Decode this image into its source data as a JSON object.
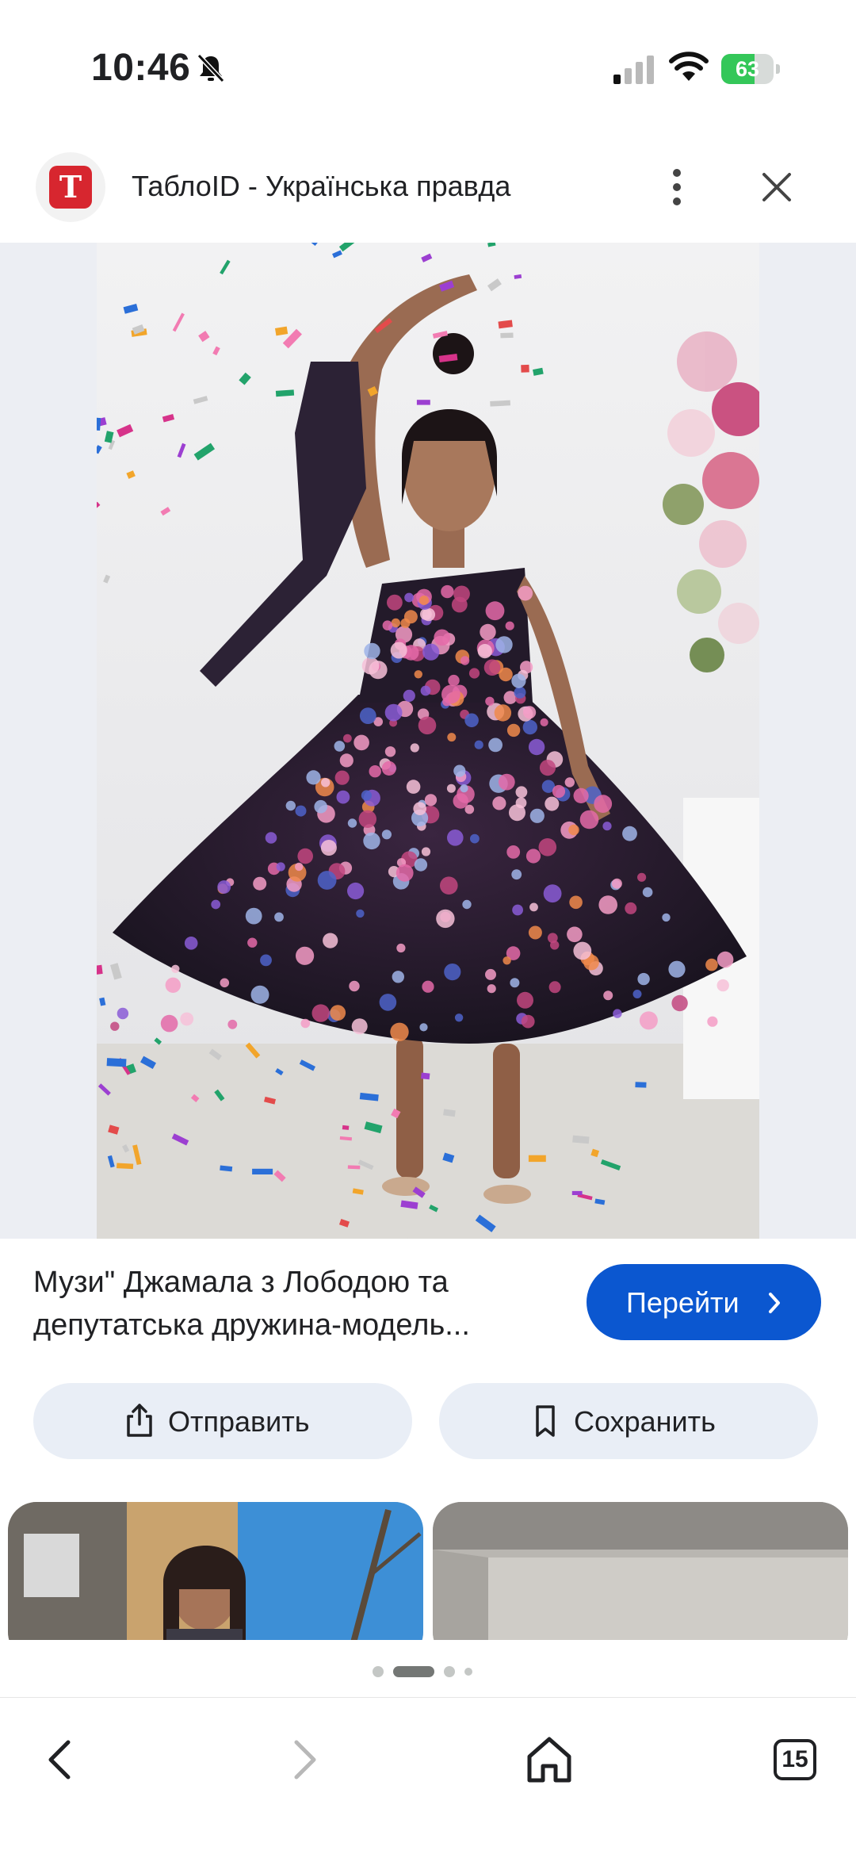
{
  "status_bar": {
    "time": "10:46",
    "battery_percent": "63",
    "battery_level": 0.63,
    "icons": [
      "bell-slash-icon",
      "cellular-signal-icon",
      "wifi-icon",
      "battery-charging-icon"
    ]
  },
  "source": {
    "favicon_letter": "T",
    "title": "ТаблоID - Українська правда",
    "brand_color": "#d7262f"
  },
  "caption": {
    "line1": "Музи\" Джамала з Лободою та",
    "line2": "депутатська дружина-модель..."
  },
  "visit_button": {
    "label": "Перейти"
  },
  "actions": {
    "share_label": "Отправить",
    "save_label": "Сохранить"
  },
  "pagination": {
    "total": 4,
    "active_index": 1
  },
  "bottom_nav": {
    "tab_count": "15",
    "icons": [
      "back-icon",
      "forward-icon",
      "home-icon",
      "tabs-icon"
    ]
  },
  "colors": {
    "accent": "#0b57d0",
    "action_bg": "#e9eef6",
    "image_bg": "#eceef3"
  }
}
